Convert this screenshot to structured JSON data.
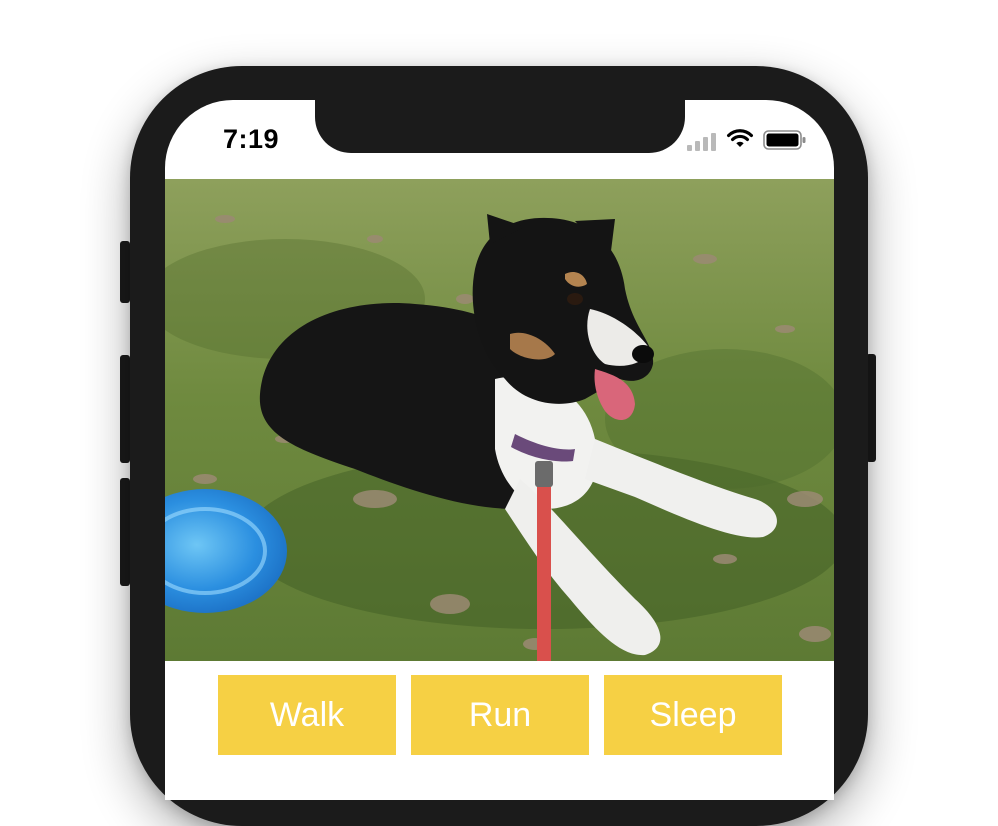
{
  "status_bar": {
    "time": "7:19",
    "icons": [
      "cellular-signal-icon",
      "wifi-icon",
      "battery-icon"
    ]
  },
  "photo": {
    "subject": "dog-photo",
    "alt": "Photo of a black, white and tan dog lying on grass with a blue frisbee and red leash"
  },
  "actions": {
    "walk_label": "Walk",
    "run_label": "Run",
    "sleep_label": "Sleep"
  },
  "colors": {
    "button_background": "#f6d044",
    "button_text": "#ffffff",
    "phone_frame": "#1b1b1b"
  }
}
